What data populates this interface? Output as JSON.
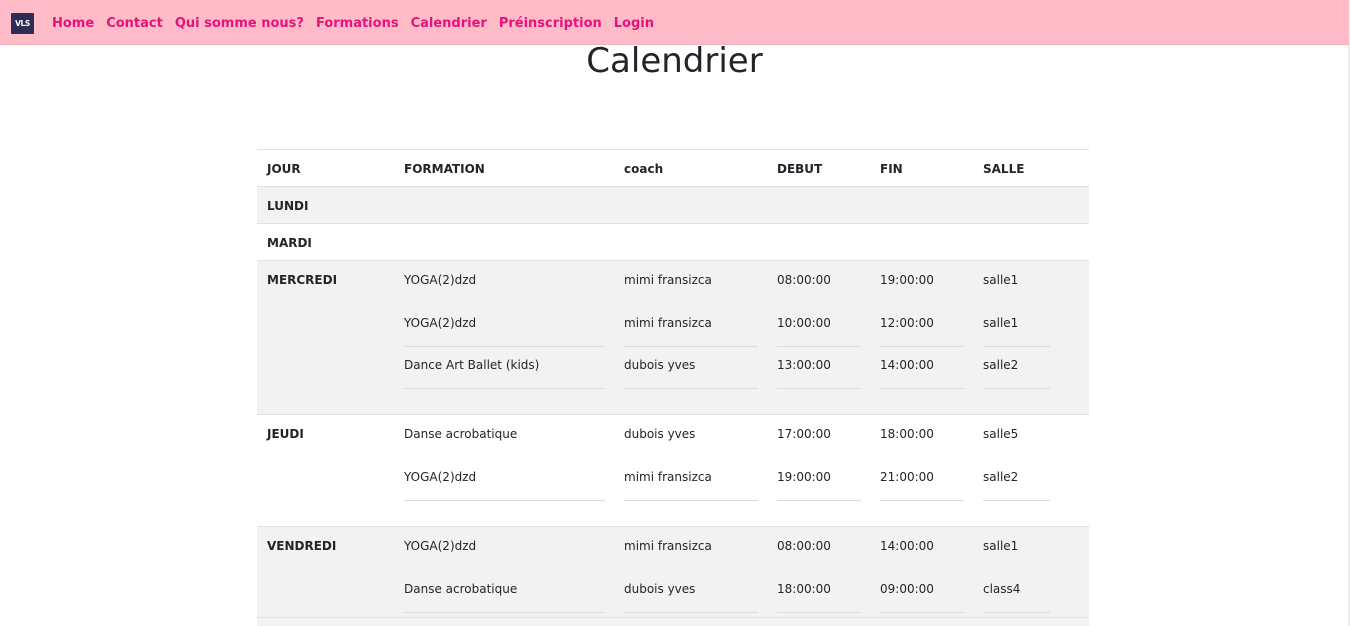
{
  "navbar": {
    "logo_text": "VLS",
    "links": [
      "Home",
      "Contact",
      "Qui somme nous?",
      "Formations",
      "Calendrier",
      "Préinscription",
      "Login"
    ]
  },
  "page_title": "Calendrier",
  "table": {
    "headers": [
      "JOUR",
      "FORMATION",
      "coach",
      "DEBUT",
      "FIN",
      "SALLE"
    ],
    "days": [
      {
        "day": "LUNDI",
        "entries": []
      },
      {
        "day": "MARDI",
        "entries": []
      },
      {
        "day": "MERCREDI",
        "entries": [
          {
            "formation": "YOGA(2)dzd",
            "coach": "mimi fransizca",
            "debut": "08:00:00",
            "fin": "19:00:00",
            "salle": "salle1"
          },
          {
            "formation": "YOGA(2)dzd",
            "coach": "mimi fransizca",
            "debut": "10:00:00",
            "fin": "12:00:00",
            "salle": "salle1"
          },
          {
            "formation": "Dance Art Ballet (kids)",
            "coach": "dubois yves",
            "debut": "13:00:00",
            "fin": "14:00:00",
            "salle": "salle2"
          }
        ]
      },
      {
        "day": "JEUDI",
        "entries": [
          {
            "formation": "Danse acrobatique",
            "coach": "dubois yves",
            "debut": "17:00:00",
            "fin": "18:00:00",
            "salle": "salle5"
          },
          {
            "formation": "YOGA(2)dzd",
            "coach": "mimi fransizca",
            "debut": "19:00:00",
            "fin": "21:00:00",
            "salle": "salle2"
          }
        ]
      },
      {
        "day": "VENDREDI",
        "entries": [
          {
            "formation": "YOGA(2)dzd",
            "coach": "mimi fransizca",
            "debut": "08:00:00",
            "fin": "14:00:00",
            "salle": "salle1"
          },
          {
            "formation": "Danse acrobatique",
            "coach": "dubois yves",
            "debut": "18:00:00",
            "fin": "09:00:00",
            "salle": "class4"
          }
        ]
      }
    ]
  }
}
